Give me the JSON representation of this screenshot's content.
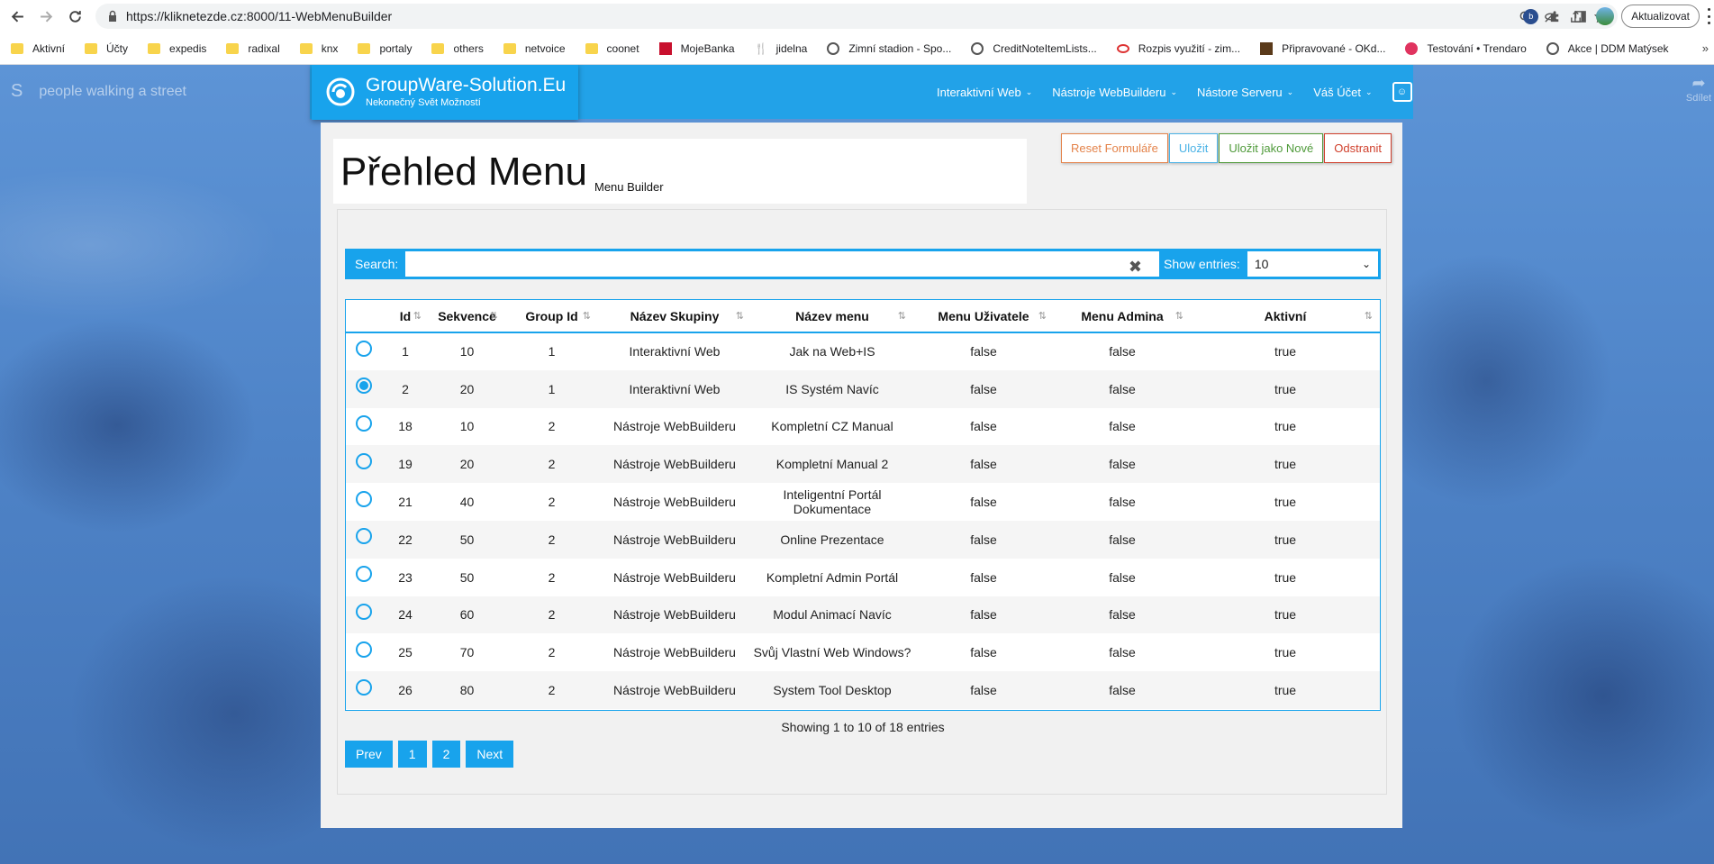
{
  "browser": {
    "url": "https://kliknetezde.cz:8000/11-WebMenuBuilder",
    "update_label": "Aktualizovat",
    "bookmarks": [
      {
        "label": "Aktivní",
        "icon": "folder-icon"
      },
      {
        "label": "Účty",
        "icon": "folder-icon"
      },
      {
        "label": "expedis",
        "icon": "folder-icon"
      },
      {
        "label": "radixal",
        "icon": "folder-icon"
      },
      {
        "label": "knx",
        "icon": "folder-icon"
      },
      {
        "label": "portaly",
        "icon": "folder-icon"
      },
      {
        "label": "others",
        "icon": "folder-icon"
      },
      {
        "label": "netvoice",
        "icon": "folder-icon"
      },
      {
        "label": "coonet",
        "icon": "folder-icon"
      },
      {
        "label": "MojeBanka",
        "icon": "bank-icon"
      },
      {
        "label": "jidelna",
        "icon": "cutlery-icon"
      },
      {
        "label": "Zimní stadion - Spo...",
        "icon": "globe-icon"
      },
      {
        "label": "CreditNoteItemLists...",
        "icon": "globe-icon"
      },
      {
        "label": "Rozpis využití - zim...",
        "icon": "link-icon"
      },
      {
        "label": "Připravované - OKd...",
        "icon": "site-icon"
      },
      {
        "label": "Testování • Trendaro",
        "icon": "pig-icon"
      },
      {
        "label": "Akce | DDM Matýsek",
        "icon": "globe-icon"
      }
    ],
    "more": "»"
  },
  "background": {
    "caption_letter": "S",
    "caption": "people walking a street",
    "share_label": "Sdílet"
  },
  "header": {
    "brand_title": "GroupWare-Solution.Eu",
    "brand_subtitle": "Nekonečný Svět Možností",
    "nav": [
      "Interaktivní Web",
      "Nástroje WebBuilderu",
      "Nástore Serveru",
      "Váš Účet"
    ]
  },
  "page": {
    "title": "Přehled Menu",
    "subtitle": "Menu Builder"
  },
  "actions": {
    "reset": "Reset Formuláře",
    "save": "Uložit",
    "save_new": "Uložit jako Nové",
    "delete": "Odstranit"
  },
  "search": {
    "label": "Search:",
    "value": "",
    "clear": "✖"
  },
  "entries": {
    "label": "Show entries:",
    "value": "10"
  },
  "table": {
    "columns": [
      "",
      "Id",
      "Sekvence",
      "Group Id",
      "Název Skupiny",
      "Název menu",
      "Menu Uživatele",
      "Menu Admina",
      "Aktivní"
    ],
    "selected_row": 1,
    "rows": [
      [
        "1",
        "10",
        "1",
        "Interaktivní Web",
        "Jak na Web+IS",
        "false",
        "false",
        "true"
      ],
      [
        "2",
        "20",
        "1",
        "Interaktivní Web",
        "IS Systém Navíc",
        "false",
        "false",
        "true"
      ],
      [
        "18",
        "10",
        "2",
        "Nástroje WebBuilderu",
        "Kompletní CZ Manual",
        "false",
        "false",
        "true"
      ],
      [
        "19",
        "20",
        "2",
        "Nástroje WebBuilderu",
        "Kompletní Manual 2",
        "false",
        "false",
        "true"
      ],
      [
        "21",
        "40",
        "2",
        "Nástroje WebBuilderu",
        "Inteligentní Portál Dokumentace",
        "false",
        "false",
        "true"
      ],
      [
        "22",
        "50",
        "2",
        "Nástroje WebBuilderu",
        "Online Prezentace",
        "false",
        "false",
        "true"
      ],
      [
        "23",
        "50",
        "2",
        "Nástroje WebBuilderu",
        "Kompletní Admin Portál",
        "false",
        "false",
        "true"
      ],
      [
        "24",
        "60",
        "2",
        "Nástroje WebBuilderu",
        "Modul Animací Navíc",
        "false",
        "false",
        "true"
      ],
      [
        "25",
        "70",
        "2",
        "Nástroje WebBuilderu",
        "Svůj Vlastní Web Windows?",
        "false",
        "false",
        "true"
      ],
      [
        "26",
        "80",
        "2",
        "Nástroje WebBuilderu",
        "System Tool Desktop",
        "false",
        "false",
        "true"
      ]
    ]
  },
  "footer": {
    "showing": "Showing 1 to 10 of 18 entries",
    "pager": [
      "Prev",
      "1",
      "2",
      "Next"
    ]
  },
  "colors": {
    "accent": "#18a3ec",
    "reset": "#e4834a",
    "save": "#4ab2e6",
    "save_new": "#4f9a3a",
    "delete": "#d0402c"
  }
}
